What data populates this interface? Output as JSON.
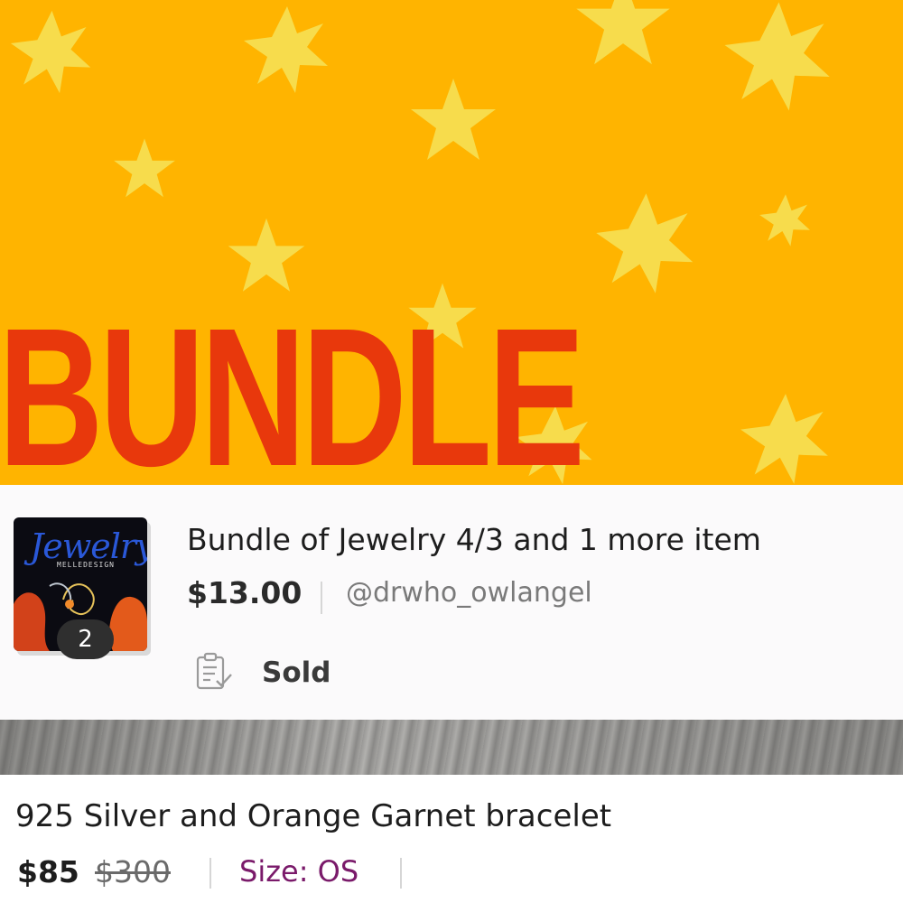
{
  "hero": {
    "banner_text": "BUNDLE",
    "background_color": "#ffb400",
    "text_color": "#e8380c",
    "star_color": "#f7dc4c"
  },
  "bundle": {
    "thumbnail": {
      "script_text": "Jewelry",
      "sub_text": "MELLEDESIGN"
    },
    "item_count": "2",
    "title": "Bundle of Jewelry 4/3 and 1 more item",
    "price": "$13.00",
    "seller": "@drwho_owlangel",
    "status_icon": "clipboard-check-icon",
    "status": "Sold"
  },
  "listing": {
    "title": "925 Silver and Orange Garnet bracelet",
    "price": "$85",
    "original_price": "$300",
    "size": "Size: OS",
    "size_color": "#7a1a6a"
  }
}
